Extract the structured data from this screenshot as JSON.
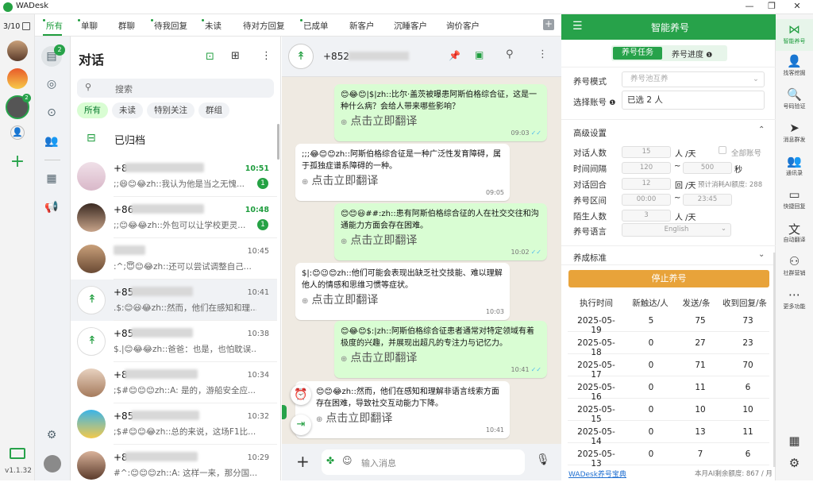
{
  "app": {
    "title": "WADesk",
    "version": "v1.1.32"
  },
  "window_controls": {
    "minimize": "—",
    "maximize": "❐",
    "close": "✕"
  },
  "account_counter": "3/10",
  "tabs": [
    {
      "label": "所有",
      "active": true,
      "dot": true
    },
    {
      "label": "单聊",
      "dot": true
    },
    {
      "label": "群聊"
    },
    {
      "label": "待我回复",
      "dot": true
    },
    {
      "label": "未读",
      "dot": true
    },
    {
      "label": "待对方回复"
    },
    {
      "label": "已成单",
      "dot": true
    },
    {
      "label": "新客户"
    },
    {
      "label": "沉睡客户"
    },
    {
      "label": "询价客户"
    }
  ],
  "nav": {
    "badge": "2"
  },
  "chatlist": {
    "title": "对话",
    "search_placeholder": "搜索",
    "filters": [
      "所有",
      "未读",
      "特别关注",
      "群组"
    ],
    "archived": "已归档",
    "items": [
      {
        "name": "+8",
        "preview": ";;😄😊😂zh::我认为他是当之无愧...",
        "time": "10:51",
        "unread": "1",
        "avatar": "girl1"
      },
      {
        "name": "+86",
        "preview": ";;😊😂😂zh::外包可以让学校更灵...",
        "time": "10:48",
        "unread": "1",
        "avatar": "girl2"
      },
      {
        "name": "",
        "preview": ":^;😇😊😂zh::还可以尝试调整自己...",
        "time": "10:45",
        "avatar": "man1"
      },
      {
        "name": "+85",
        "preview": ".$:😊😃😂zh::然而，他们在感知和理...",
        "time": "10:41",
        "avatar": "logo",
        "selected": true
      },
      {
        "name": "+85",
        "preview": "$.|😊😂😂zh::爸爸：也是，也怕耽误...",
        "time": "10:38",
        "avatar": "logo"
      },
      {
        "name": "+8",
        "preview": ";$#😊😊😊zh::A: 是的，游船安全应...",
        "time": "10:34",
        "avatar": "girl3"
      },
      {
        "name": "+85",
        "preview": ";$#😊😊😂zh::总的来说，这场F1比...",
        "time": "10:32",
        "avatar": "girl4"
      },
      {
        "name": "+8",
        "preview": "#^:😊😊😊zh::A: 这样一来，那分国...",
        "time": "10:29",
        "avatar": "girl5"
      }
    ]
  },
  "chat": {
    "contact": "+852",
    "translate_hint": "点击立即翻译",
    "input_placeholder": "输入消息",
    "messages": [
      {
        "dir": "out",
        "text": "😊😂😊|$|zh::比尔·盖茨被曝患阿斯伯格综合征，这是一种什么病？会给人带来哪些影响？",
        "time": "09:03",
        "ticks": true
      },
      {
        "dir": "in",
        "text": ";;;😂😊😊zh::阿斯伯格综合征是一种广泛性发育障碍，属于孤独症谱系障碍的一种。",
        "time": "09:05"
      },
      {
        "dir": "out",
        "text": "😊😊😃##:zh::患有阿斯伯格综合征的人在社交交往和沟通能力方面会存在困难。",
        "time": "10:02",
        "ticks": true
      },
      {
        "dir": "in",
        "text": "$|:😊😉😊zh::他们可能会表现出缺乏社交技能、难以理解他人的情感和思维习惯等症状。",
        "time": "10:03"
      },
      {
        "dir": "out",
        "text": "😊😂😊$:|zh::阿斯伯格综合征患者通常对特定领域有着极度的兴趣，并展现出超凡的专注力与记忆力。",
        "time": "10:41",
        "ticks": true
      },
      {
        "dir": "in",
        "text": "😊😊😂zh::然而，他们在感知和理解非语言线索方面存在困难，导致社交互动能力下降。",
        "time": "10:41"
      }
    ]
  },
  "panel": {
    "title": "智能养号",
    "tab_task": "养号任务",
    "tab_progress": "养号进度",
    "mode_label": "养号模式",
    "mode_value": "养号池互养",
    "account_label": "选择账号",
    "account_value": "已选 2 人",
    "advanced": "高级设置",
    "fields": [
      {
        "label": "对话人数",
        "a": "15",
        "unit": "人 /天"
      },
      {
        "label": "时间间隔",
        "a": "120",
        "b": "500",
        "unit": "秒"
      },
      {
        "label": "对话回合",
        "a": "12",
        "unit": "回 /天"
      },
      {
        "label": "养号区间",
        "a": "00:00",
        "b": "23:45"
      },
      {
        "label": "陌生人数",
        "a": "3",
        "unit": "人 /天"
      }
    ],
    "all_accounts": "全部账号",
    "ai_estimate": "预计消耗AI额度: 288",
    "lang_label": "养号语言",
    "lang_value": "English",
    "standard": "养成标准",
    "stop_button": "停止养号",
    "table_headers": [
      "执行时间",
      "新触达/人",
      "发送/条",
      "收到回复/条"
    ],
    "table_rows": [
      [
        "2025-05-19",
        "5",
        "75",
        "73"
      ],
      [
        "2025-05-18",
        "0",
        "27",
        "23"
      ],
      [
        "2025-05-17",
        "0",
        "71",
        "70"
      ],
      [
        "2025-05-16",
        "0",
        "11",
        "6"
      ],
      [
        "2025-05-15",
        "0",
        "10",
        "10"
      ],
      [
        "2025-05-14",
        "0",
        "13",
        "11"
      ],
      [
        "2025-05-13",
        "0",
        "7",
        "6"
      ]
    ],
    "footer_link": "WADesk养号宝典",
    "footer_quota": "本月AI剩余额度: 867 / 月"
  },
  "rightrail": [
    {
      "label": "智能养号",
      "icon": "share-icon"
    },
    {
      "label": "找客挖掘",
      "icon": "user-search-icon"
    },
    {
      "label": "号码验证",
      "icon": "verify-icon"
    },
    {
      "label": "消息群发",
      "icon": "send-icon"
    },
    {
      "label": "通讯录",
      "icon": "contacts-icon"
    },
    {
      "label": "快捷回复",
      "icon": "quick-reply-icon"
    },
    {
      "label": "自动翻译",
      "icon": "translate-icon"
    },
    {
      "label": "社群营销",
      "icon": "community-icon"
    },
    {
      "label": "更多功能",
      "icon": "more-icon"
    }
  ],
  "colors": {
    "brand": "#27a24a",
    "stop_button": "#e8a33a",
    "out_bubble": "#d9fdd3"
  }
}
